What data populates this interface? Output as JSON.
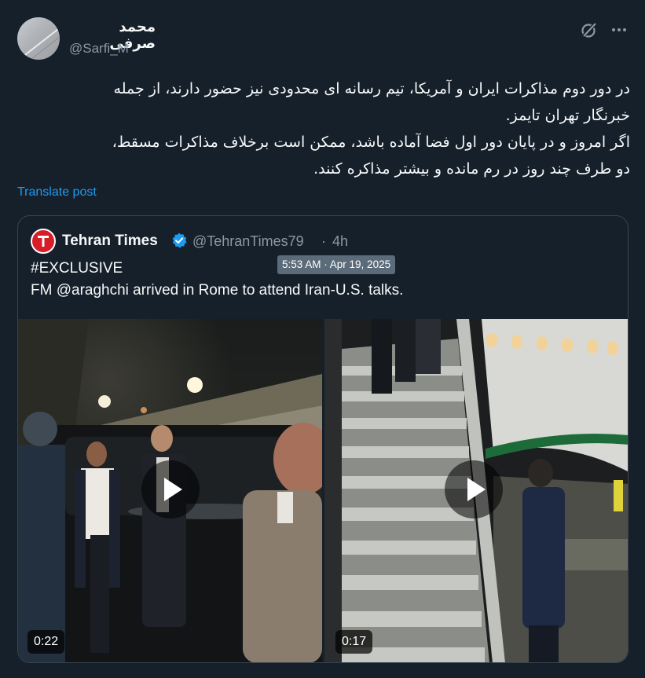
{
  "post": {
    "display_name": "محمد صرفی",
    "handle": "@Sarfi_M",
    "text_lines": [
      "در دور دوم مذاکرات ایران و آمریکا، تیم رسانه ای محدودی نیز حضور دارند، از جمله",
      "خبرنگار تهران تایمز.",
      "اگر امروز و در پایان دور اول فضا آماده باشد، ممکن است برخلاف مذاکرات مسقط،",
      "دو طرف چند روز در رم مانده و بیشتر مذاکره کنند."
    ],
    "translate_label": "Translate post"
  },
  "icons": {
    "grok": "grok-icon",
    "more": "more-icon",
    "verified": "verified-icon",
    "play": "play-icon"
  },
  "quote": {
    "display_name": "Tehran Times",
    "handle": "@TehranTimes79",
    "separator": "·",
    "relative_time": "4h",
    "tooltip": "5:53 AM · Apr 19, 2025",
    "line1": "#EXCLUSIVE",
    "line2": "FM @araghchi arrived in Rome to attend Iran-U.S. talks."
  },
  "videos": [
    {
      "duration": "0:22"
    },
    {
      "duration": "0:17"
    }
  ],
  "colors": {
    "background": "#15202b",
    "link": "#1d9bf0",
    "secondary_text": "#8b98a5",
    "border": "#38444d",
    "verified": "#1d9bf0"
  }
}
